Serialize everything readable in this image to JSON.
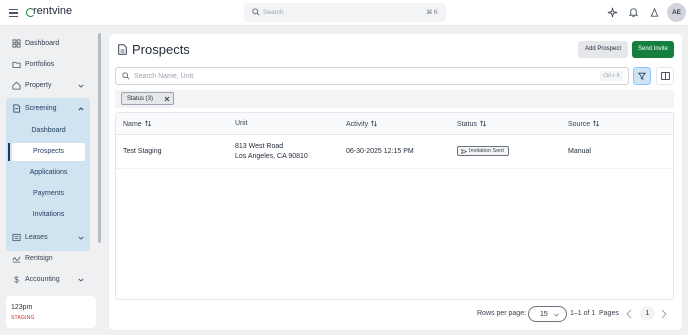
{
  "app": {
    "logo_text": "rentvine"
  },
  "topbar": {
    "search_placeholder": "Search",
    "search_shortcut": "⌘ K",
    "avatar_initials": "AE"
  },
  "sidebar": {
    "items": [
      {
        "label": "Dashboard",
        "icon": "dashboard-icon"
      },
      {
        "label": "Portfolios",
        "icon": "portfolio-icon"
      },
      {
        "label": "Property",
        "icon": "property-icon"
      },
      {
        "label": "Screening",
        "icon": "screening-icon"
      },
      {
        "label": "Leases",
        "icon": "lease-icon"
      },
      {
        "label": "Rentsign",
        "icon": "signature-icon"
      },
      {
        "label": "Accounting",
        "icon": "dollar-icon"
      }
    ],
    "screening_sub": [
      "Dashboard",
      "Prospects",
      "Applications",
      "Payments",
      "Invitations"
    ],
    "active_sub": "Prospects",
    "account_name": "123pm",
    "account_env": "STAGING"
  },
  "main": {
    "title": "Prospects",
    "add_button": "Add Prospect",
    "send_button": "Send Invite",
    "search_placeholder": "Search Name, Unit",
    "search_shortcut": "Ctrl + K",
    "filter_chip": "Status (3)"
  },
  "table": {
    "columns": [
      "Name",
      "Unit",
      "Activity",
      "Status",
      "Source"
    ],
    "rows": [
      {
        "name": "Test Staging",
        "unit_line1": "813 West Road",
        "unit_line2": "Los Angeles, CA 90810",
        "activity": "06-30-2025 12:15 PM",
        "status": "Invitation Sent",
        "source": "Manual"
      }
    ]
  },
  "pagination": {
    "rows_per_page_label": "Rows per page:",
    "rows_per_page": "15",
    "range": "1–1 of 1",
    "pages_label": "Pages",
    "current_page": "1"
  },
  "colors": {
    "brand_green": "#15803d",
    "active_nav_bg": "#cfe3f0",
    "staging_red": "#dc2626"
  }
}
